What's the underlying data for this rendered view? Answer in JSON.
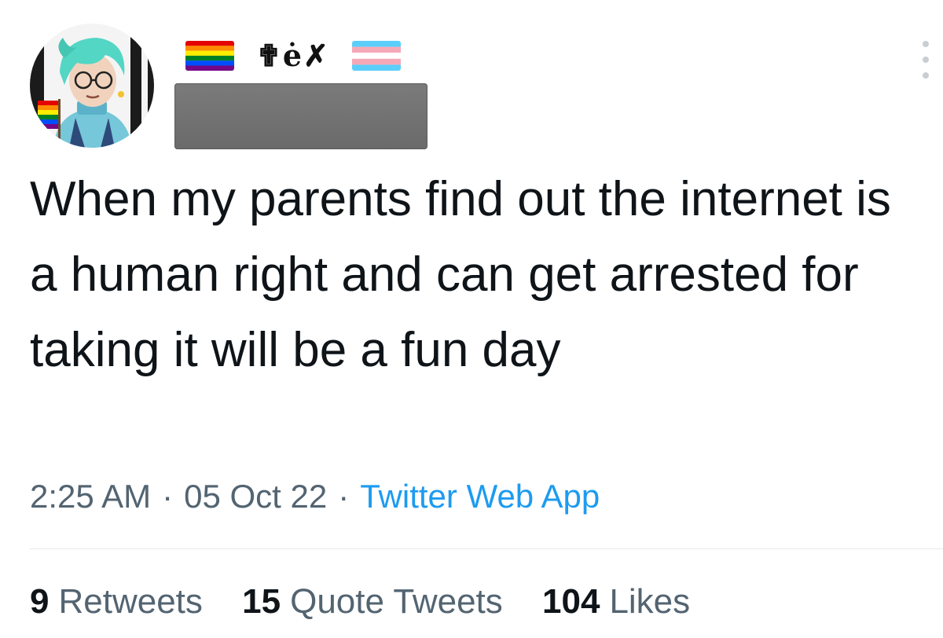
{
  "header": {
    "flag_left_icon": "rainbow-pride-flag-icon",
    "display_glyphs": "✟ė✗",
    "flag_right_icon": "transgender-flag-icon",
    "avatar_icon": "illustrated-avatar-teal-hair",
    "handle_redacted": true,
    "more_icon": "more-vertical-icon"
  },
  "tweet": {
    "text": "When my parents find out the internet is a human right and can get arrested for taking it will be a fun day",
    "time": "2:25 AM",
    "separator": "·",
    "date": "05 Oct 22",
    "source": "Twitter Web App"
  },
  "stats": {
    "retweets_count": "9",
    "retweets_label": "Retweets",
    "quotes_count": "15",
    "quotes_label": "Quote Tweets",
    "likes_count": "104",
    "likes_label": "Likes"
  },
  "colors": {
    "text": "#0f1419",
    "secondary": "#536471",
    "link": "#1d9bf0",
    "divider": "#e6e9ec"
  }
}
